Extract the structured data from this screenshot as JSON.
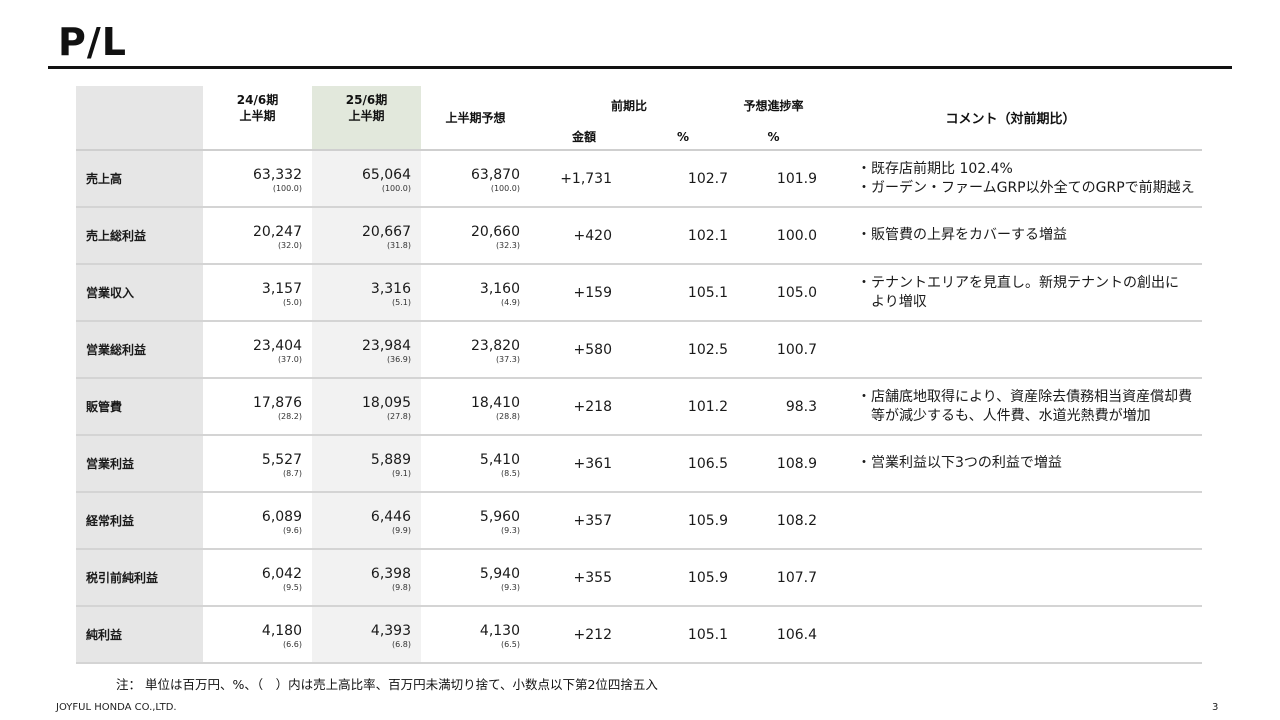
{
  "title": "P/L",
  "header": {
    "col_prev": [
      "24/6期",
      "上半期"
    ],
    "col_cur": [
      "25/6期",
      "上半期"
    ],
    "col_forecast": "上半期予想",
    "col_yoy": "前期比",
    "col_yoy_amount": "金額",
    "col_yoy_pct": "%",
    "col_progress": "予想進捗率",
    "col_progress_pct": "%",
    "col_comment": "コメント（対前期比）"
  },
  "rows": [
    {
      "label": "売上高",
      "prev": "63,332",
      "prev_ratio": "(100.0)",
      "cur": "65,064",
      "cur_ratio": "(100.0)",
      "forecast": "63,870",
      "forecast_ratio": "(100.0)",
      "diff": "+1,731",
      "pct": "102.7",
      "progress": "101.9",
      "comment": [
        "・既存店前期比 102.4%",
        "・ガーデン・ファームGRP以外全てのGRPで前期越え"
      ]
    },
    {
      "label": "売上総利益",
      "prev": "20,247",
      "prev_ratio": "(32.0)",
      "cur": "20,667",
      "cur_ratio": "(31.8)",
      "forecast": "20,660",
      "forecast_ratio": "(32.3)",
      "diff": "+420",
      "pct": "102.1",
      "progress": "100.0",
      "comment": [
        "・販管費の上昇をカバーする増益"
      ]
    },
    {
      "label": "営業収入",
      "prev": "3,157",
      "prev_ratio": "(5.0)",
      "cur": "3,316",
      "cur_ratio": "(5.1)",
      "forecast": "3,160",
      "forecast_ratio": "(4.9)",
      "diff": "+159",
      "pct": "105.1",
      "progress": "105.0",
      "comment": [
        "・テナントエリアを見直し。新規テナントの創出に",
        "より増収"
      ]
    },
    {
      "label": "営業総利益",
      "prev": "23,404",
      "prev_ratio": "(37.0)",
      "cur": "23,984",
      "cur_ratio": "(36.9)",
      "forecast": "23,820",
      "forecast_ratio": "(37.3)",
      "diff": "+580",
      "pct": "102.5",
      "progress": "100.7",
      "comment": []
    },
    {
      "label": "販管費",
      "prev": "17,876",
      "prev_ratio": "(28.2)",
      "cur": "18,095",
      "cur_ratio": "(27.8)",
      "forecast": "18,410",
      "forecast_ratio": "(28.8)",
      "diff": "+218",
      "pct": "101.2",
      "progress": "98.3",
      "comment": [
        "・店舗底地取得により、資産除去債務相当資産償却費",
        "等が減少するも、人件費、水道光熱費が増加"
      ]
    },
    {
      "label": "営業利益",
      "prev": "5,527",
      "prev_ratio": "(8.7)",
      "cur": "5,889",
      "cur_ratio": "(9.1)",
      "forecast": "5,410",
      "forecast_ratio": "(8.5)",
      "diff": "+361",
      "pct": "106.5",
      "progress": "108.9",
      "comment": [
        "・営業利益以下3つの利益で増益"
      ]
    },
    {
      "label": "経常利益",
      "prev": "6,089",
      "prev_ratio": "(9.6)",
      "cur": "6,446",
      "cur_ratio": "(9.9)",
      "forecast": "5,960",
      "forecast_ratio": "(9.3)",
      "diff": "+357",
      "pct": "105.9",
      "progress": "108.2",
      "comment": []
    },
    {
      "label": "税引前純利益",
      "prev": "6,042",
      "prev_ratio": "(9.5)",
      "cur": "6,398",
      "cur_ratio": "(9.8)",
      "forecast": "5,940",
      "forecast_ratio": "(9.3)",
      "diff": "+355",
      "pct": "105.9",
      "progress": "107.7",
      "comment": []
    },
    {
      "label": "純利益",
      "prev": "4,180",
      "prev_ratio": "(6.6)",
      "cur": "4,393",
      "cur_ratio": "(6.8)",
      "forecast": "4,130",
      "forecast_ratio": "(6.5)",
      "diff": "+212",
      "pct": "105.1",
      "progress": "106.4",
      "comment": []
    }
  ],
  "note": "注：  単位は百万円、%、（　）内は売上高比率、百万円未満切り捨て、小数点以下第2位四捨五入",
  "footer": {
    "company": "JOYFUL HONDA CO.,LTD.",
    "page": "3"
  }
}
